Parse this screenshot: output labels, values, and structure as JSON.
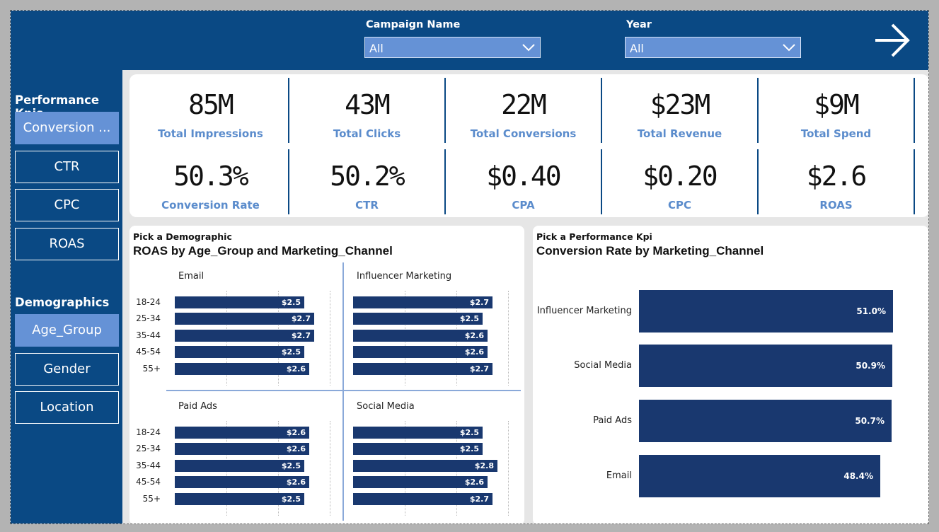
{
  "filters": {
    "campaign": {
      "label": "Campaign Name",
      "value": "All"
    },
    "year": {
      "label": "Year",
      "value": "All"
    }
  },
  "sidebar": {
    "kpi_section_title": "Performance Kpis",
    "kpi_buttons": [
      {
        "label": "Conversion ...",
        "active": true
      },
      {
        "label": "CTR",
        "active": false
      },
      {
        "label": "CPC",
        "active": false
      },
      {
        "label": "ROAS",
        "active": false
      }
    ],
    "demo_section_title": "Demographics",
    "demo_buttons": [
      {
        "label": "Age_Group",
        "active": true
      },
      {
        "label": "Gender",
        "active": false
      },
      {
        "label": "Location",
        "active": false
      }
    ]
  },
  "kpis": [
    {
      "value": "85M",
      "label": "Total Impressions"
    },
    {
      "value": "43M",
      "label": "Total Clicks"
    },
    {
      "value": "22M",
      "label": "Total Conversions"
    },
    {
      "value": "$23M",
      "label": "Total Revenue"
    },
    {
      "value": "$9M",
      "label": "Total Spend"
    },
    {
      "value": "50.3%",
      "label": "Conversion Rate"
    },
    {
      "value": "50.2%",
      "label": "CTR"
    },
    {
      "value": "$0.40",
      "label": "CPA"
    },
    {
      "value": "$0.20",
      "label": "CPC"
    },
    {
      "value": "$2.6",
      "label": "ROAS"
    }
  ],
  "roas_panel": {
    "pick_label": "Pick a Demographic",
    "title": "ROAS by Age_Group and Marketing_Channel"
  },
  "cr_panel": {
    "pick_label": "Pick a Performance Kpi",
    "title": "Conversion Rate by Marketing_Channel"
  },
  "chart_data": [
    {
      "type": "bar",
      "title": "ROAS by Age_Group and Marketing_Channel",
      "categories": [
        "18-24",
        "25-34",
        "35-44",
        "45-54",
        "55+"
      ],
      "facets": [
        {
          "name": "Email",
          "values": [
            2.5,
            2.7,
            2.7,
            2.5,
            2.6
          ],
          "labels": [
            "$2.5",
            "$2.7",
            "$2.7",
            "$2.5",
            "$2.6"
          ]
        },
        {
          "name": "Influencer Marketing",
          "values": [
            2.7,
            2.5,
            2.6,
            2.6,
            2.7
          ],
          "labels": [
            "$2.7",
            "$2.5",
            "$2.6",
            "$2.6",
            "$2.7"
          ]
        },
        {
          "name": "Paid Ads",
          "values": [
            2.6,
            2.6,
            2.5,
            2.6,
            2.5
          ],
          "labels": [
            "$2.6",
            "$2.6",
            "$2.5",
            "$2.6",
            "$2.5"
          ]
        },
        {
          "name": "Social Media",
          "values": [
            2.5,
            2.5,
            2.8,
            2.6,
            2.7
          ],
          "labels": [
            "$2.5",
            "$2.5",
            "$2.8",
            "$2.6",
            "$2.7"
          ]
        }
      ],
      "xlim": [
        0,
        3.0
      ],
      "color": "#19386f"
    },
    {
      "type": "bar",
      "title": "Conversion Rate by Marketing_Channel",
      "categories": [
        "Influencer Marketing",
        "Social Media",
        "Paid Ads",
        "Email"
      ],
      "values": [
        51.0,
        50.9,
        50.7,
        48.4
      ],
      "labels": [
        "51.0%",
        "50.9%",
        "50.7%",
        "48.4%"
      ],
      "xlim": [
        0,
        51.0
      ],
      "color": "#19386f"
    }
  ],
  "colors": {
    "navy": "#0a4984",
    "accent": "#6592d6",
    "bar": "#19386f",
    "kpi_label": "#5b8ccc"
  }
}
